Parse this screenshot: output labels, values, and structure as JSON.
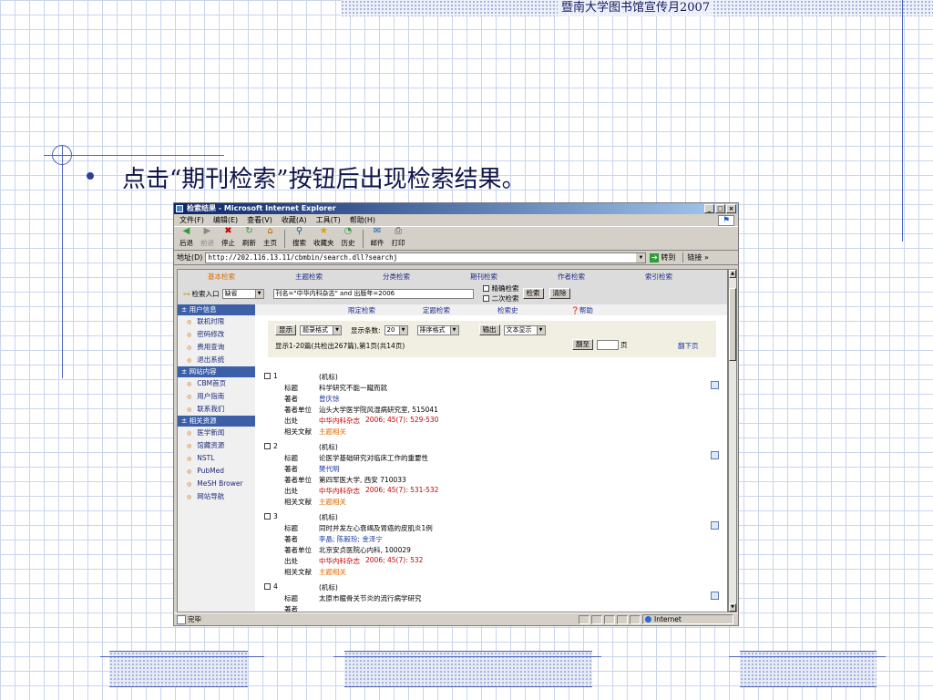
{
  "slide": {
    "header_title": "暨南大学图书馆宣传月2007",
    "bullet_text": "点击“期刊检索”按钮后出现检索结果。"
  },
  "window": {
    "title": "检索结果 - Microsoft Internet Explorer",
    "controls": [
      "_",
      "□",
      "×"
    ],
    "menu": [
      "文件(F)",
      "编辑(E)",
      "查看(V)",
      "收藏(A)",
      "工具(T)",
      "帮助(H)"
    ],
    "toolbar": [
      {
        "label": "后退",
        "icon": "back-arrow-icon"
      },
      {
        "label": "前进",
        "icon": "forward-arrow-icon"
      },
      {
        "label": "停止",
        "icon": "stop-icon"
      },
      {
        "label": "刷新",
        "icon": "refresh-icon"
      },
      {
        "label": "主页",
        "icon": "home-icon"
      },
      {
        "label": "搜索",
        "icon": "search-icon"
      },
      {
        "label": "收藏夹",
        "icon": "favorites-icon"
      },
      {
        "label": "历史",
        "icon": "history-icon"
      },
      {
        "label": "邮件",
        "icon": "mail-icon"
      },
      {
        "label": "打印",
        "icon": "print-icon"
      }
    ],
    "address_label": "地址(D)",
    "address_value": "http://202.116.13.11/cbmbin/search.dll?searchj",
    "go_label": "转到",
    "links_label": "链接 »",
    "status_text": "完毕",
    "zone_text": "Internet"
  },
  "page": {
    "tabs": [
      "基本检索",
      "主题检索",
      "分类检索",
      "期刊检索",
      "作者检索",
      "索引检索"
    ],
    "search": {
      "entry_label": "检索入口",
      "entry_value": "缺省",
      "query": "刊名=\"中华内科杂志\" and 出版年=2006",
      "precise_label": "精确检索",
      "secondary_label": "二次检索",
      "search_button": "检索",
      "clear_button": "清除"
    },
    "subtabs": [
      "限定检索",
      "定题检索",
      "检索史",
      "帮助"
    ],
    "sidebar": {
      "sections": [
        {
          "title": "用户信息",
          "items": [
            "联机时限",
            "密码修改",
            "费用查询",
            "退出系统"
          ]
        },
        {
          "title": "网站内容",
          "items": [
            "CBM首页",
            "用户指南",
            "联系我们"
          ]
        },
        {
          "title": "相关资源",
          "items": [
            "医学新闻",
            "馆藏资源",
            "NSTL",
            "PubMed",
            "MeSH Brower",
            "网站导航"
          ]
        }
      ]
    },
    "results_panel": {
      "show_button": "显示",
      "format_value": "题录格式",
      "count_label": "显示条数:",
      "count_value": "20",
      "sort_value": "排序格式",
      "output_button": "输出",
      "output_format": "文本显示",
      "summary": "显示1-20篇(共检出267篇),第1页(共14页)",
      "goto_button": "翻至",
      "page_unit": "页",
      "next_page": "翻下页"
    },
    "field_labels": {
      "title": "标题",
      "author": "著者",
      "affiliation": "著者单位",
      "source": "出处",
      "related": "相关文献"
    },
    "records": [
      {
        "num": "1",
        "type": "(机标)",
        "title": "科学研究不能一蹴而就",
        "author": "曾庆馀",
        "affiliation": "汕头大学医学院风湿病研究室, 515041",
        "journal": "中华内科杂志",
        "source_detail": "2006; 45(7): 529-530",
        "related": "主题相关"
      },
      {
        "num": "2",
        "type": "(机标)",
        "title": "论医学基础研究对临床工作的重要性",
        "author": "樊代明",
        "affiliation": "第四军医大学, 西安 710033",
        "journal": "中华内科杂志",
        "source_detail": "2006; 45(7): 531-532",
        "related": "主题相关"
      },
      {
        "num": "3",
        "type": "(机标)",
        "title": "同时并发左心衰竭及胃癌的皮肌炎1例",
        "author": "李晶; 陈毅玢; 金泽宁",
        "affiliation": "北京安贞医院心内科, 100029",
        "journal": "中华内科杂志",
        "source_detail": "2006; 45(7): 532",
        "related": "主题相关"
      },
      {
        "num": "4",
        "type": "(机标)",
        "title": "太原市髋骨关节炎的流行病学研究",
        "author": "",
        "affiliation": "",
        "journal": "",
        "source_detail": "",
        "related": ""
      }
    ]
  }
}
